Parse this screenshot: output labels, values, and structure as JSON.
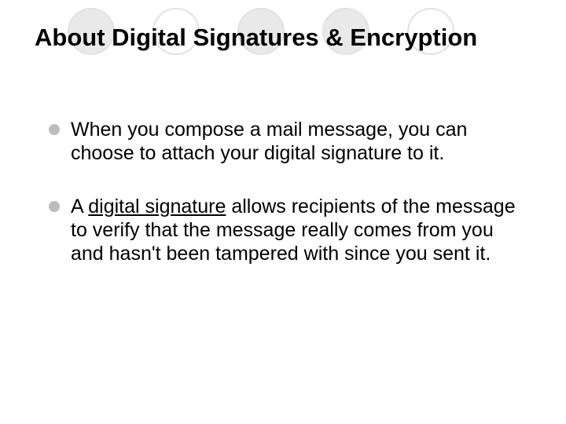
{
  "title": "About Digital Signatures & Encryption",
  "bullets": [
    {
      "pre": "When you compose a mail message, you can choose to attach your digital signature to it.",
      "underlined": "",
      "post": ""
    },
    {
      "pre": "A ",
      "underlined": "digital signature",
      "post": " allows recipients of the message to verify that the message really comes from you and hasn't been tampered with since you sent it."
    }
  ]
}
